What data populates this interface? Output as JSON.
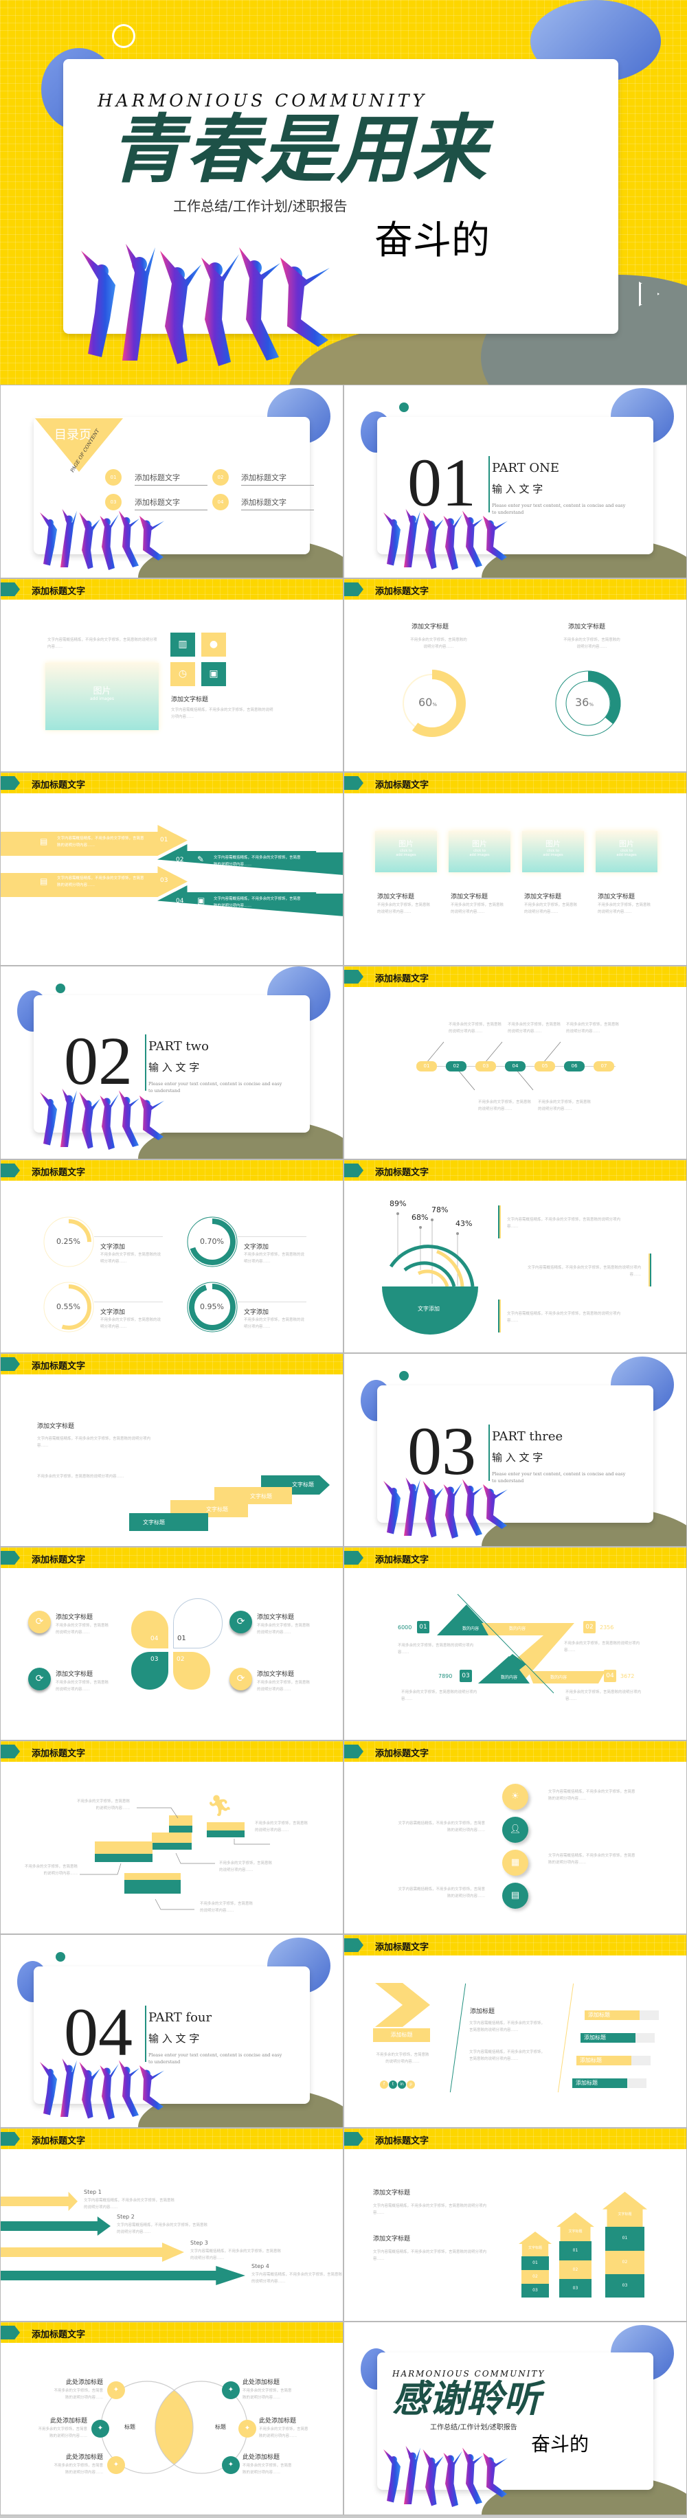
{
  "colors": {
    "yellow": "#fdd600",
    "teal": "#21907f",
    "light_yellow": "#fddb7a",
    "title_green": "#1d5147",
    "blue": "#5a7fd8"
  },
  "header_title": "添加标题文字",
  "placeholder": "文字内容需概括精炼，不用多余的文字修饰，言简意赅的说明分项内容……",
  "short": "不用多余的文字修饰，言简意赅的说明分项内容……",
  "cover": {
    "eyebrow": "HARMONIOUS COMMUNITY",
    "title": "青春是用来",
    "subtitle": "工作总结/工作计划/述职报告",
    "tagline": "奋斗的"
  },
  "toc": {
    "label": "目录页",
    "sub": "PAGE OF CONTENT",
    "items": [
      {
        "num": "01",
        "text": "添加标题文字"
      },
      {
        "num": "02",
        "text": "添加标题文字"
      },
      {
        "num": "03",
        "text": "添加标题文字"
      },
      {
        "num": "04",
        "text": "添加标题文字"
      }
    ]
  },
  "section_cn": "输 入 文 字",
  "section_en": "Please enter your text content, content is concise and easy to understand",
  "sections": [
    {
      "num": "01",
      "part": "PART ONE"
    },
    {
      "num": "02",
      "part": "PART two"
    },
    {
      "num": "03",
      "part": "PART three"
    },
    {
      "num": "04",
      "part": "PART four"
    }
  ],
  "image_ph": {
    "label": "图片",
    "hint1": "click to",
    "hint2": "add images"
  },
  "icons_slide": {
    "subtitle": "添加文字标题"
  },
  "donuts": [
    {
      "title": "添加文字标题",
      "label": "60",
      "unit": "%",
      "fraction": 0.6,
      "color": "#fddb7a"
    },
    {
      "title": "添加文字标题",
      "label": "36",
      "unit": "%",
      "fraction": 0.36,
      "color": "#21907f"
    }
  ],
  "arrows": [
    "01",
    "02",
    "03",
    "04"
  ],
  "gallery": [
    "添加文字标题",
    "添加文字标题",
    "添加文字标题",
    "添加文字标题"
  ],
  "timeline": [
    "01",
    "02",
    "03",
    "04",
    "05",
    "06",
    "07"
  ],
  "rings": [
    {
      "value": "0.25%",
      "label": "文字添加",
      "fraction": 0.25,
      "color": "#fddb7a"
    },
    {
      "value": "0.70%",
      "label": "文字添加",
      "fraction": 0.7,
      "color": "#21907f"
    },
    {
      "value": "0.55%",
      "label": "文字添加",
      "fraction": 0.55,
      "color": "#fddb7a"
    },
    {
      "value": "0.95%",
      "label": "文字添加",
      "fraction": 0.95,
      "color": "#21907f"
    }
  ],
  "arcs": {
    "values": [
      "89%",
      "68%",
      "78%",
      "43%"
    ],
    "center": "文字添加"
  },
  "stairs": {
    "title": "添加文字标题",
    "steps": [
      "文字标题",
      "文字标题",
      "文字标题",
      "文字标题"
    ]
  },
  "clover": {
    "petals": [
      "01",
      "02",
      "03",
      "04"
    ],
    "items": [
      "添加文字标题",
      "添加文字标题",
      "添加文字标题",
      "添加文字标题"
    ]
  },
  "zchart": {
    "rows": [
      {
        "num": "01",
        "value": "6000",
        "label": "数的内容"
      },
      {
        "num": "02",
        "value": "2356",
        "label": "数的内容"
      },
      {
        "num": "03",
        "value": "7890",
        "label": "数的内容"
      },
      {
        "num": "04",
        "value": "3672",
        "label": "数的内容"
      }
    ]
  },
  "chevron_slide": {
    "chevron_label": "添加标题",
    "title": "添加标题",
    "bars": [
      "添加标题",
      "添加标题",
      "添加标题",
      "添加标题"
    ],
    "social": [
      "f",
      "t",
      "in",
      "p"
    ]
  },
  "steps": [
    "Step 1",
    "Step 2",
    "Step 3",
    "Step 4"
  ],
  "growth": {
    "titles": [
      "添加文字标题",
      "添加文字标题"
    ],
    "column_top": "文字标题",
    "levels": [
      "01",
      "02",
      "03"
    ]
  },
  "venn": {
    "items": [
      "此处添加标题",
      "此处添加标题",
      "此处添加标题",
      "此处添加标题",
      "此处添加标题",
      "此处添加标题"
    ],
    "left": "标题",
    "right": "标题"
  },
  "closing": {
    "eyebrow": "HARMONIOUS COMMUNITY",
    "title": "感谢聆听",
    "subtitle": "工作总结/工作计划/述职报告",
    "tagline": "奋斗的"
  }
}
